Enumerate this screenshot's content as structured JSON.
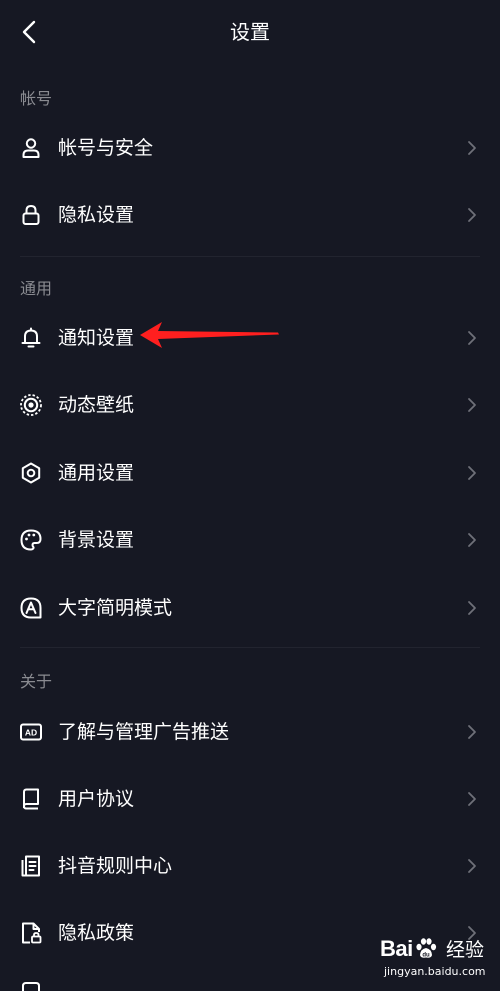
{
  "header": {
    "title": "设置"
  },
  "sections": {
    "account": {
      "label": "帐号",
      "items": [
        {
          "label": "帐号与安全",
          "icon": "user-icon"
        },
        {
          "label": "隐私设置",
          "icon": "lock-icon"
        }
      ]
    },
    "general": {
      "label": "通用",
      "items": [
        {
          "label": "通知设置",
          "icon": "bell-icon"
        },
        {
          "label": "动态壁纸",
          "icon": "live-wallpaper-icon"
        },
        {
          "label": "通用设置",
          "icon": "gear-icon"
        },
        {
          "label": "背景设置",
          "icon": "palette-icon"
        },
        {
          "label": "大字简明模式",
          "icon": "large-text-icon"
        }
      ]
    },
    "about": {
      "label": "关于",
      "items": [
        {
          "label": "了解与管理广告推送",
          "icon": "ad-icon"
        },
        {
          "label": "用户协议",
          "icon": "book-icon"
        },
        {
          "label": "抖音规则中心",
          "icon": "rules-doc-icon"
        },
        {
          "label": "隐私政策",
          "icon": "privacy-doc-icon"
        }
      ]
    }
  },
  "colors": {
    "background": "#161823",
    "text_primary": "#ffffff",
    "text_secondary": "#8a8b91",
    "annotation_arrow": "#ff1f1f"
  },
  "watermark": {
    "logo_left": "Bai",
    "logo_right": "经验",
    "url": "jingyan.baidu.com"
  }
}
